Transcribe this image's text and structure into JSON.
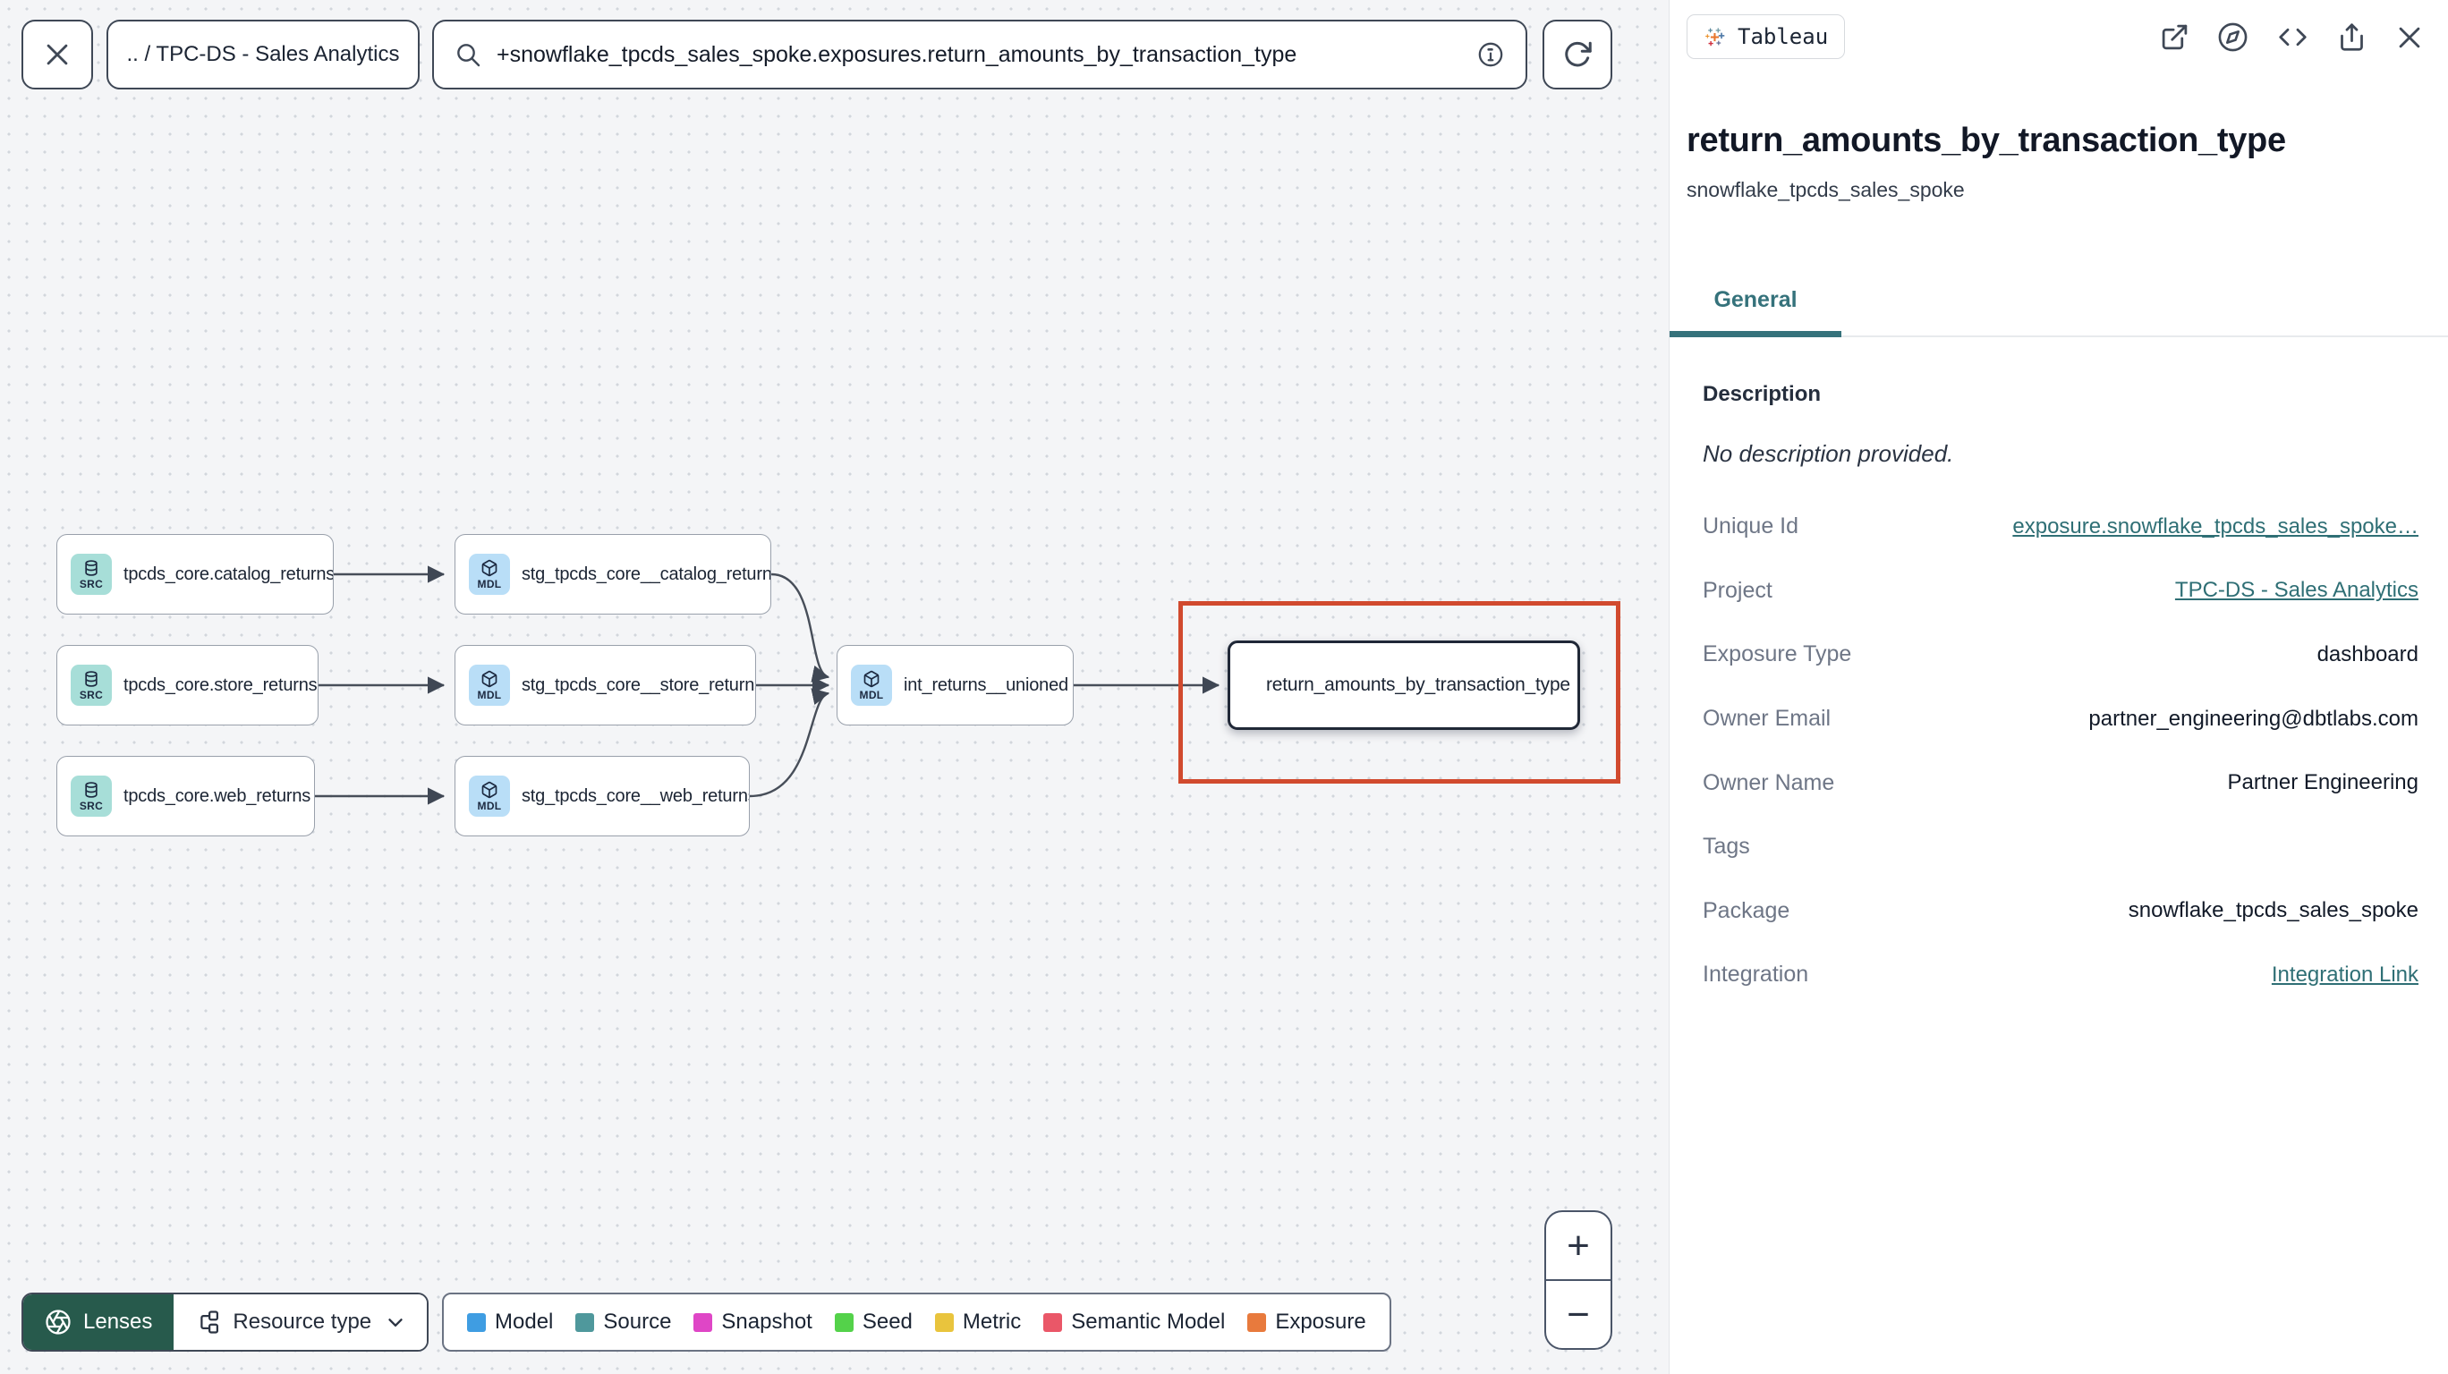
{
  "toolbar": {
    "breadcrumb": ".. / TPC-DS - Sales Analytics",
    "search_value": "+snowflake_tpcds_sales_spoke.exposures.return_amounts_by_transaction_type"
  },
  "graph": {
    "nodes": [
      {
        "badge": "SRC",
        "label": "tpcds_core.catalog_returns"
      },
      {
        "badge": "MDL",
        "label": "stg_tpcds_core__catalog_returns"
      },
      {
        "badge": "SRC",
        "label": "tpcds_core.store_returns"
      },
      {
        "badge": "MDL",
        "label": "stg_tpcds_core__store_returns"
      },
      {
        "badge": "SRC",
        "label": "tpcds_core.web_returns"
      },
      {
        "badge": "MDL",
        "label": "stg_tpcds_core__web_returns"
      },
      {
        "badge": "MDL",
        "label": "int_returns__unioned"
      },
      {
        "badge": "tableau-icon",
        "label": "return_amounts_by_transaction_type",
        "selected": true
      }
    ]
  },
  "footer": {
    "lenses_label": "Lenses",
    "resource_type_label": "Resource type",
    "legend": [
      {
        "label": "Model",
        "color": "#3f9de2"
      },
      {
        "label": "Source",
        "color": "#4f989c"
      },
      {
        "label": "Snapshot",
        "color": "#df46c6"
      },
      {
        "label": "Seed",
        "color": "#54d24a"
      },
      {
        "label": "Metric",
        "color": "#e9c43d"
      },
      {
        "label": "Semantic Model",
        "color": "#ea5768"
      },
      {
        "label": "Exposure",
        "color": "#e87a3d"
      }
    ]
  },
  "zoom_controls": {
    "zoom_in": "+",
    "zoom_out": "−"
  },
  "panel": {
    "tool_badge": "Tableau",
    "title": "return_amounts_by_transaction_type",
    "subtitle": "snowflake_tpcds_sales_spoke",
    "tab": "General",
    "description_heading": "Description",
    "description_empty": "No description provided.",
    "fields": [
      {
        "label": "Unique Id",
        "value": "exposure.snowflake_tpcds_sales_spoke…",
        "link": true
      },
      {
        "label": "Project",
        "value": "TPC-DS - Sales Analytics",
        "link": true
      },
      {
        "label": "Exposure Type",
        "value": "dashboard",
        "link": false
      },
      {
        "label": "Owner Email",
        "value": "partner_engineering@dbtlabs.com",
        "link": false
      },
      {
        "label": "Owner Name",
        "value": "Partner Engineering",
        "link": false
      },
      {
        "label": "Tags",
        "value": "",
        "link": false
      },
      {
        "label": "Package",
        "value": "snowflake_tpcds_sales_spoke",
        "link": false
      },
      {
        "label": "Integration",
        "value": "Integration Link",
        "link": true
      }
    ]
  },
  "colors": {
    "selection_highlight": "#d14a2e",
    "link_teal": "#2f6f75",
    "active_tab_teal": "#35727b",
    "lenses_green": "#275a4c",
    "source_badge": "#a7ded8",
    "model_badge": "#b9def7"
  }
}
